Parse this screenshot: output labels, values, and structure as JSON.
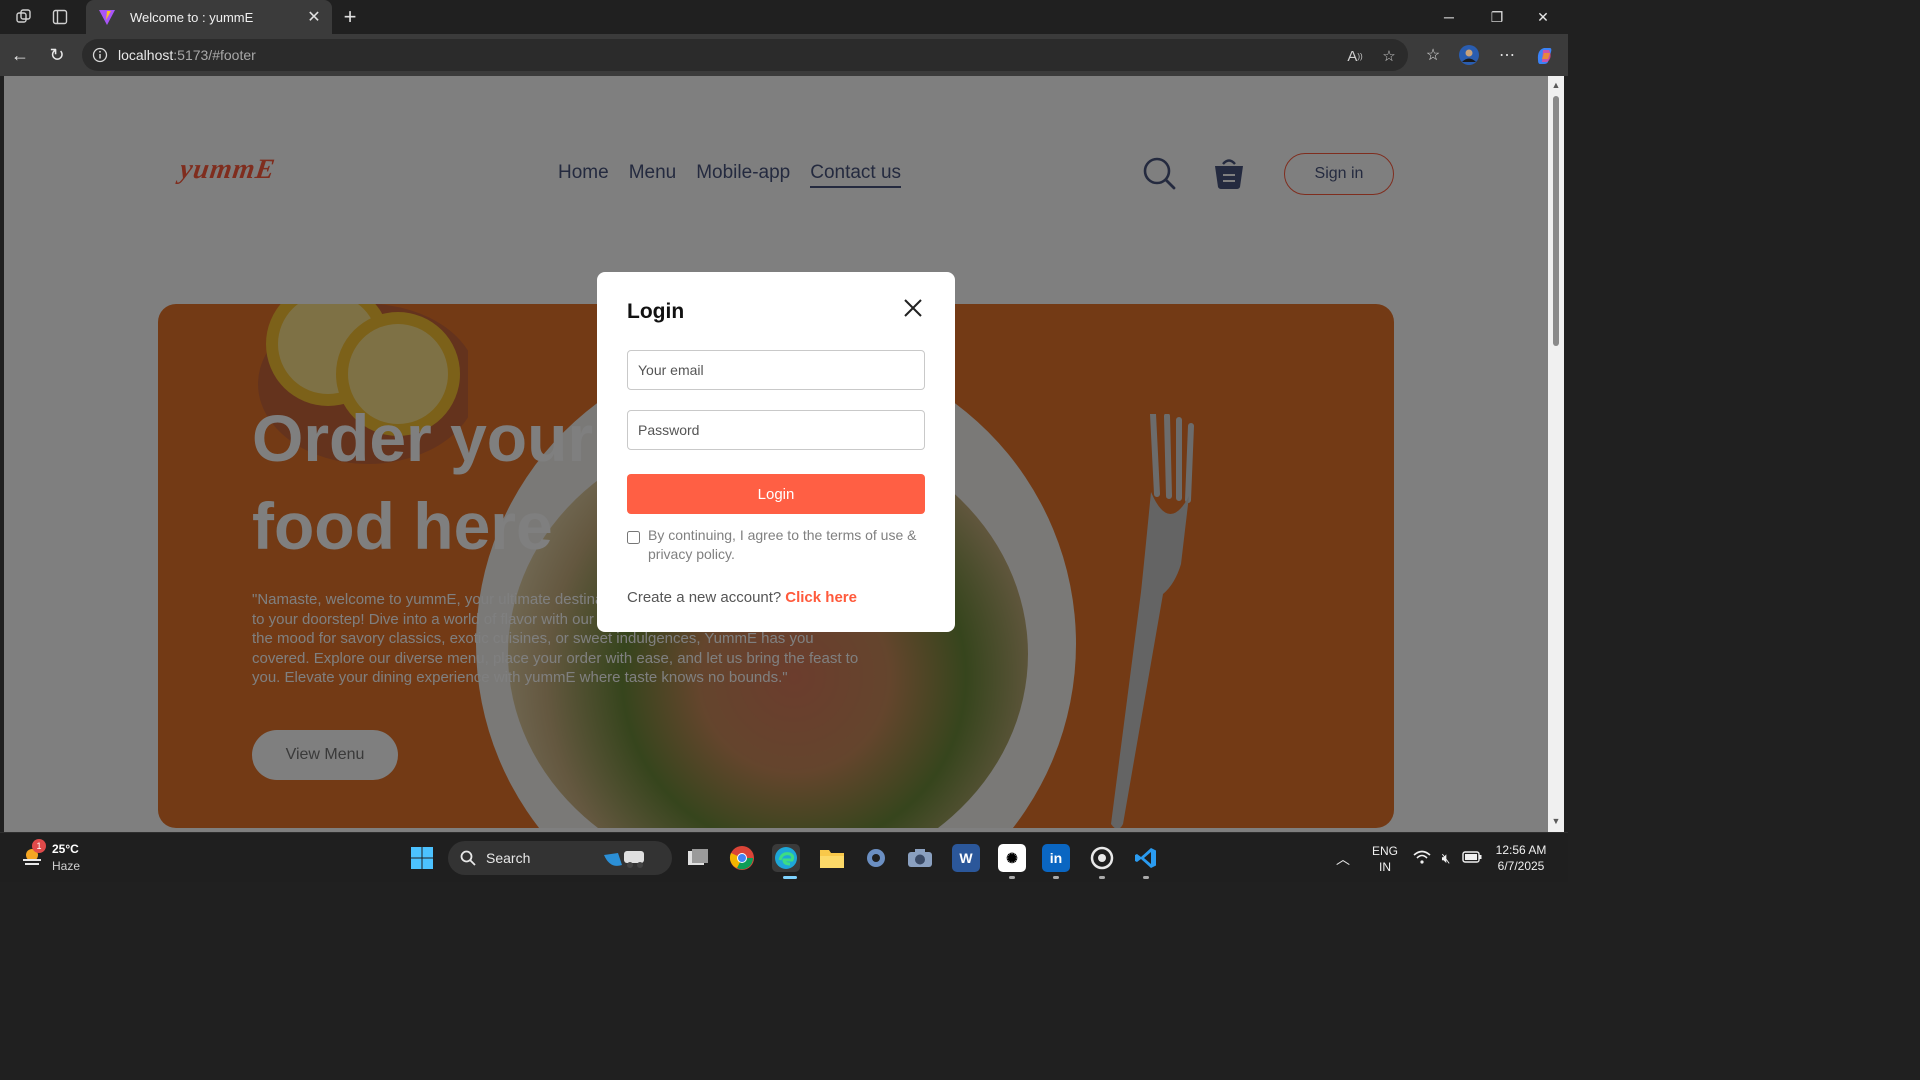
{
  "browser": {
    "tab_title": "Welcome to : yummE",
    "url_host": "localhost",
    "url_rest": ":5173/#footer"
  },
  "page": {
    "logo": "yummE",
    "nav": [
      "Home",
      "Menu",
      "Mobile-app",
      "Contact us"
    ],
    "active_nav": "Contact us",
    "signin_label": "Sign in",
    "hero": {
      "title": "Order your favourite food here",
      "text": "\"Namaste, welcome to yummE, your ultimate destination for delicious meals delivered right to your doorstep! Dive into a world of flavor with our wide range of dishes. Whether you're in the mood for savory classics, exotic cuisines, or sweet indulgences, YummE has you covered. Explore our diverse menu, place your order with ease, and let us bring the feast to you. Elevate your dining experience with yummE where taste knows no bounds.\"",
      "button": "View Menu"
    }
  },
  "login_popup": {
    "title": "Login",
    "email_placeholder": "Your email",
    "password_placeholder": "Password",
    "submit_label": "Login",
    "terms_text": "By continuing, I agree to the terms of use & privacy policy.",
    "terms_checked": false,
    "create_prompt": "Create a new account?",
    "create_link": "Click here"
  },
  "taskbar": {
    "weather_temp": "25°C",
    "weather_desc": "Haze",
    "weather_badge": "1",
    "search_label": "Search",
    "lang_top": "ENG",
    "lang_bottom": "IN",
    "time": "12:56 AM",
    "date": "6/7/2025"
  },
  "colors": {
    "accent": "#ff5a3c",
    "nav_text": "#49557e",
    "hero_bg": "#e7742a"
  }
}
